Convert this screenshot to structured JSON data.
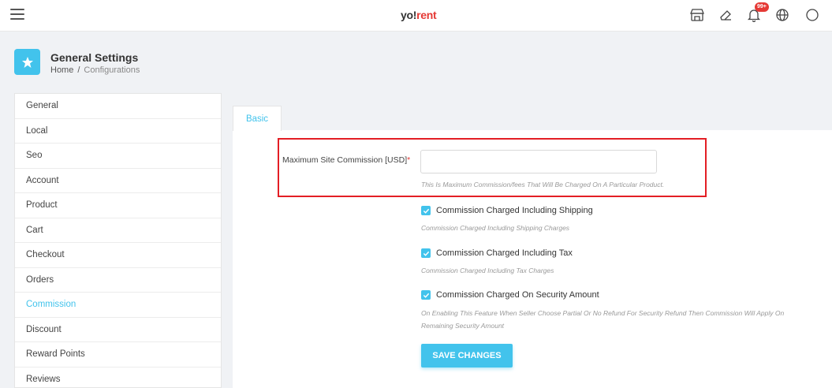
{
  "topbar": {
    "logo_part1": "yo!",
    "logo_part2": "rent",
    "notification_badge": "99+",
    "icons": [
      "menu-icon",
      "store-icon",
      "eraser-icon",
      "bell-icon",
      "globe-icon"
    ]
  },
  "page_header": {
    "title": "General Settings",
    "breadcrumb": {
      "home": "Home",
      "separator": "/",
      "current": "Configurations"
    }
  },
  "sidebar": {
    "items": [
      {
        "label": "General"
      },
      {
        "label": "Local"
      },
      {
        "label": "Seo"
      },
      {
        "label": "Account"
      },
      {
        "label": "Product"
      },
      {
        "label": "Cart"
      },
      {
        "label": "Checkout"
      },
      {
        "label": "Orders"
      },
      {
        "label": "Commission",
        "active": true
      },
      {
        "label": "Discount"
      },
      {
        "label": "Reward Points"
      },
      {
        "label": "Reviews"
      }
    ]
  },
  "tabs": [
    {
      "label": "Basic"
    }
  ],
  "form": {
    "max_commission": {
      "label": "Maximum Site Commission [USD]",
      "required_mark": "*",
      "value": "",
      "help": "This Is Maximum Commission/fees That Will Be Charged On A Particular Product."
    },
    "checkboxes": [
      {
        "label": "Commission Charged Including Shipping",
        "help": "Commission Charged Including Shipping Charges",
        "checked": true
      },
      {
        "label": "Commission Charged Including Tax",
        "help": "Commission Charged Including Tax Charges",
        "checked": true
      },
      {
        "label": "Commission Charged On Security Amount",
        "help": "On Enabling This Feature When Seller Choose Partial Or No Refund For Security Refund Then Commission Will Apply On",
        "help_line2": "Remaining Security Amount",
        "checked": true
      }
    ],
    "save_label": "SAVE CHANGES"
  },
  "colors": {
    "accent": "#42c3ec",
    "highlight_border": "#e31e24",
    "badge": "#e53935"
  }
}
